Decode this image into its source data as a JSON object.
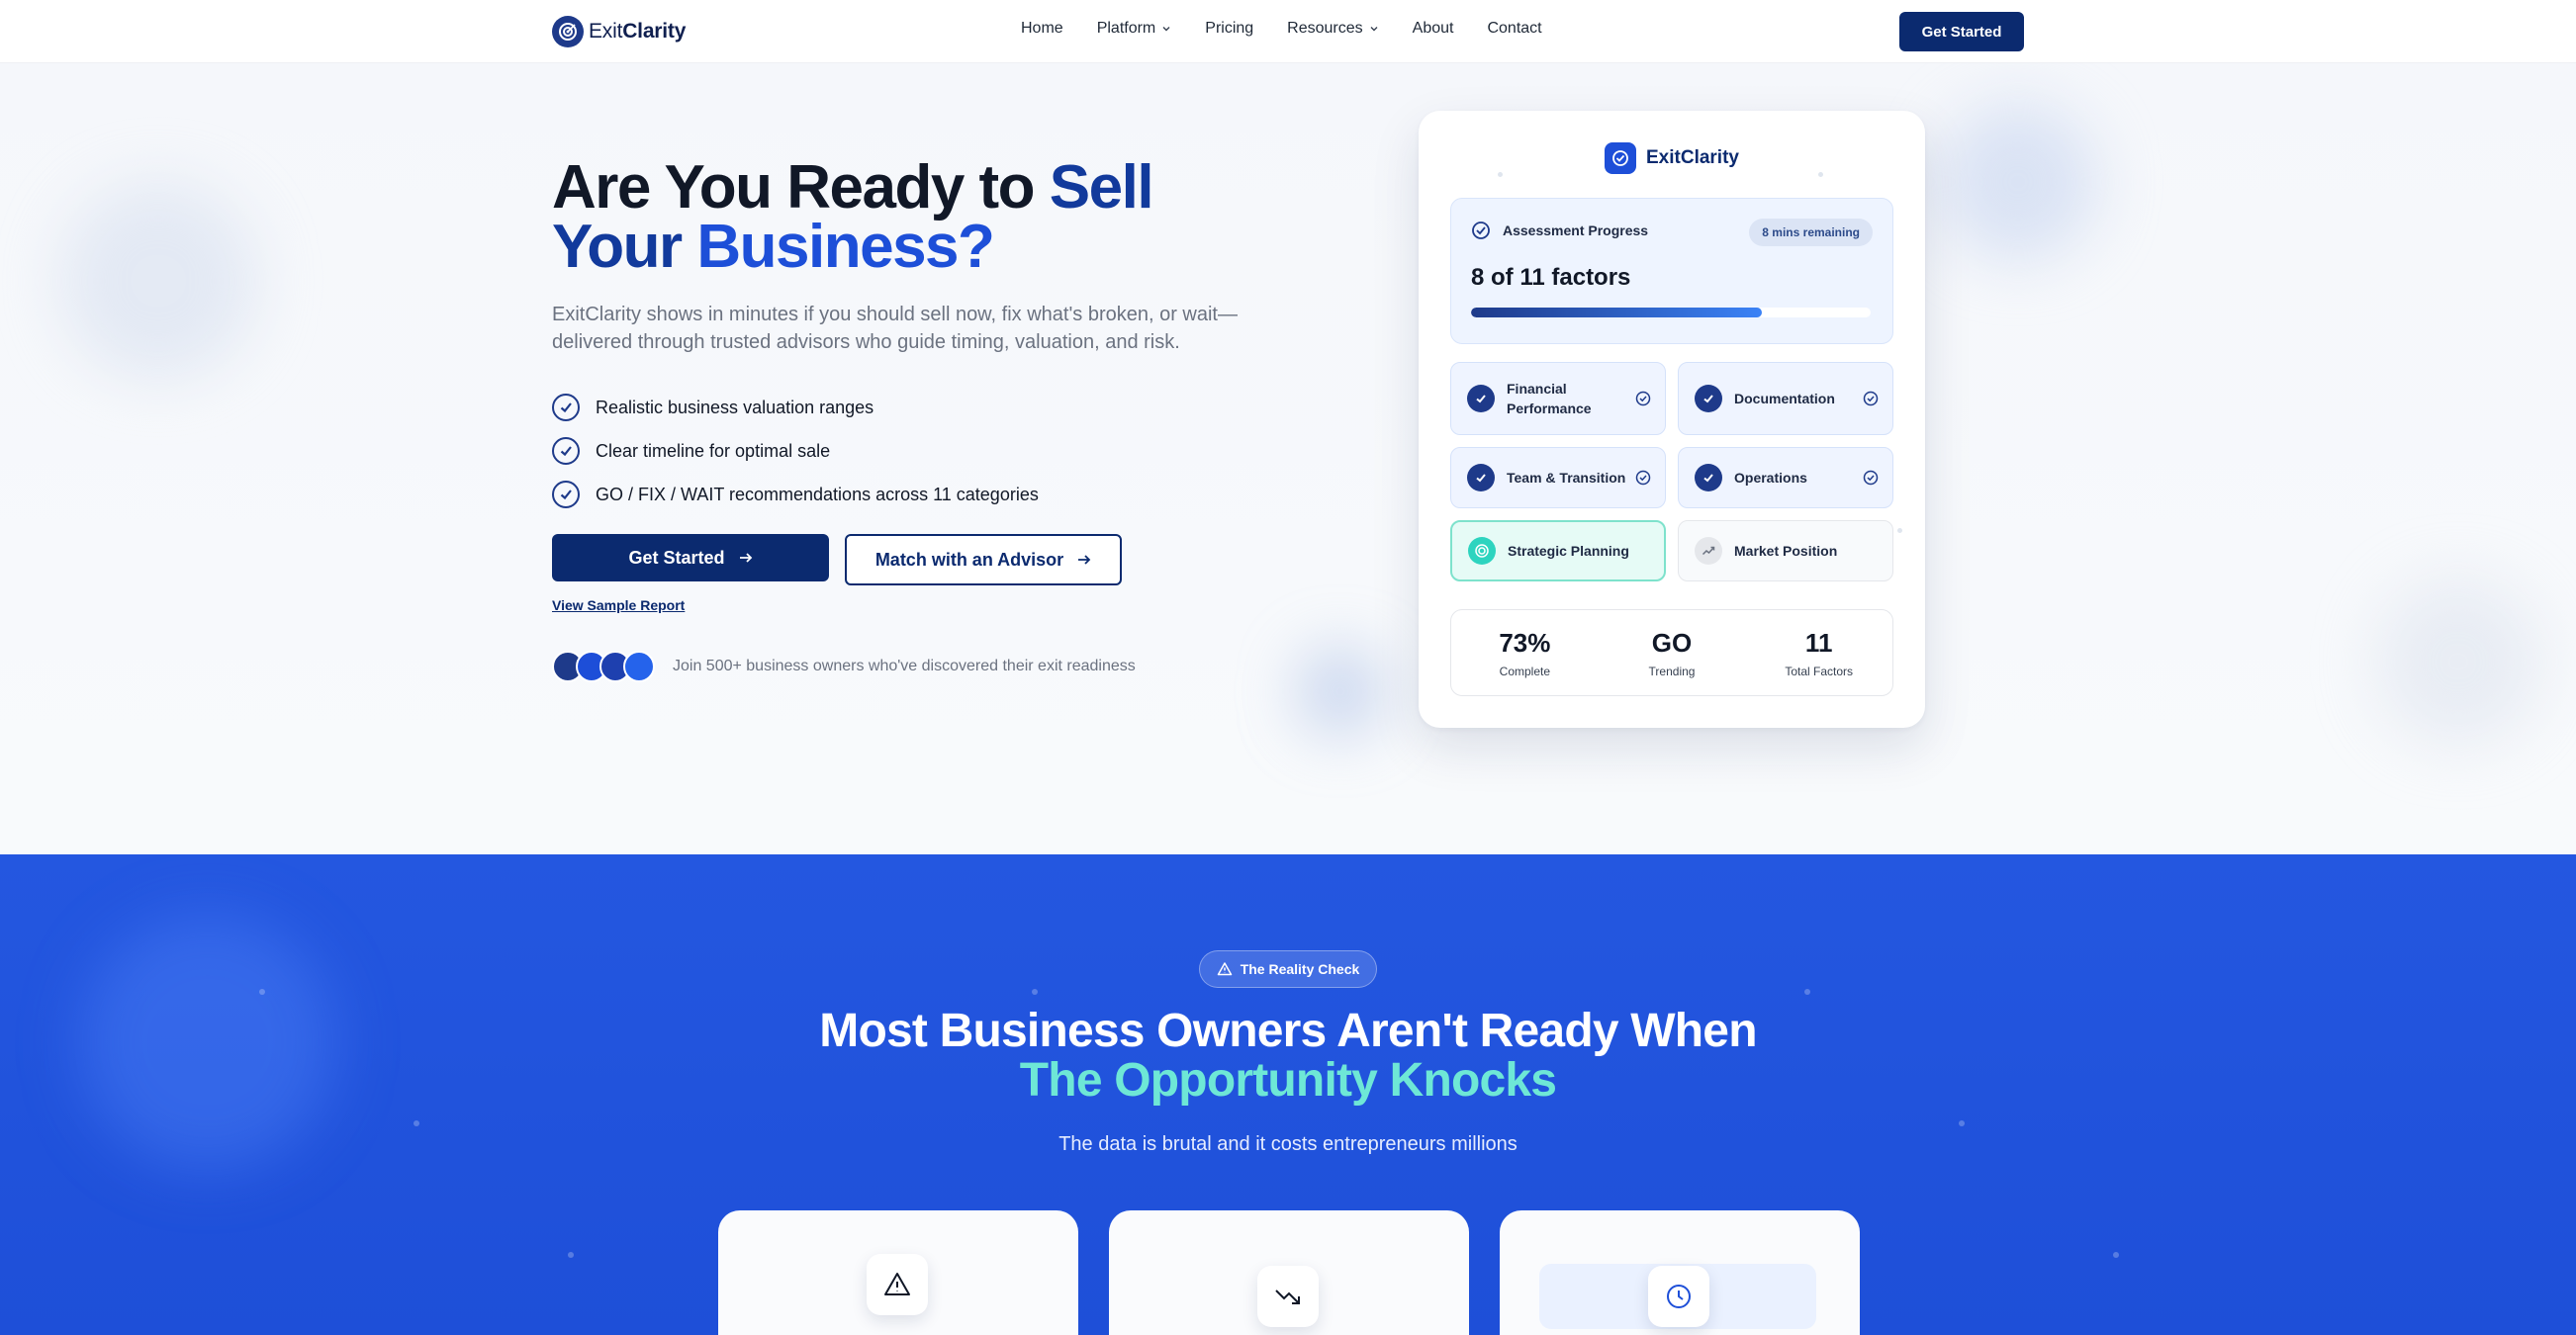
{
  "nav": {
    "brand_light": "Exit",
    "brand_bold": "Clarity",
    "links": [
      {
        "label": "Home",
        "dropdown": false
      },
      {
        "label": "Platform",
        "dropdown": true
      },
      {
        "label": "Pricing",
        "dropdown": false
      },
      {
        "label": "Resources",
        "dropdown": true
      },
      {
        "label": "About",
        "dropdown": false
      },
      {
        "label": "Contact",
        "dropdown": false
      }
    ],
    "cta": "Get Started"
  },
  "hero": {
    "title_part1": "Are You Ready to ",
    "title_accent1": "Sell",
    "title_accent2": "Your",
    "title_accent3": "Business?",
    "subtitle": "ExitClarity shows in minutes if you should sell now, fix what's broken, or wait—delivered through trusted advisors who guide timing, valuation, and risk.",
    "bullets": [
      "Realistic business valuation ranges",
      "Clear timeline for optimal sale",
      "GO / FIX / WAIT recommendations across 11 categories"
    ],
    "primary_cta": "Get Started",
    "secondary_cta": "Match with an Advisor",
    "sample_link": "View Sample Report",
    "social_proof": "Join 500+ business owners who've discovered their exit readiness",
    "avatar_colors": [
      "#1e3a8a",
      "#1d4ed8",
      "#1e40af",
      "#2563eb"
    ]
  },
  "card": {
    "brand": "ExitClarity",
    "progress_label": "Assessment Progress",
    "time_badge": "8 mins remaining",
    "factor_count": "8 of 11 factors",
    "progress_fraction": 0.727,
    "factors": [
      {
        "label": "Financial Performance",
        "status": "done"
      },
      {
        "label": "Documentation",
        "status": "done"
      },
      {
        "label": "Team & Transition",
        "status": "done"
      },
      {
        "label": "Operations",
        "status": "done"
      },
      {
        "label": "Strategic Planning",
        "status": "active"
      },
      {
        "label": "Market Position",
        "status": "pending"
      }
    ],
    "stats": [
      {
        "value": "73%",
        "label": "Complete"
      },
      {
        "value": "GO",
        "label": "Trending"
      },
      {
        "value": "11",
        "label": "Total Factors"
      }
    ]
  },
  "reality": {
    "pill": "The Reality Check",
    "title_line1": "Most Business Owners Aren't Ready When",
    "title_line2": "The Opportunity Knocks",
    "subtitle": "The data is brutal and it costs entrepreneurs millions",
    "cards": [
      {
        "icon": "warning-icon"
      },
      {
        "icon": "trending-down-icon"
      },
      {
        "icon": "clock-icon"
      }
    ]
  }
}
